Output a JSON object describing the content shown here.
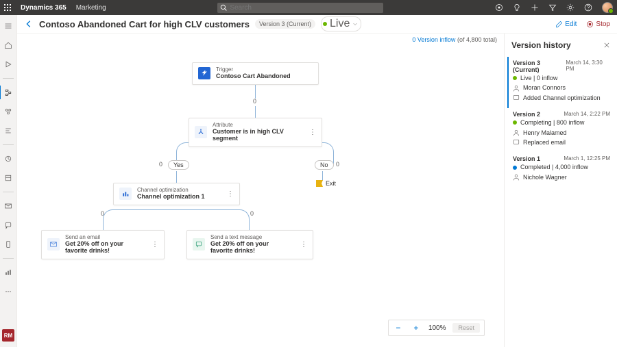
{
  "topbar": {
    "brand": "Dynamics 365",
    "app": "Marketing",
    "search_placeholder": "Search"
  },
  "rail_bottom": "RM",
  "header": {
    "title": "Contoso Abandoned Cart for high CLV customers",
    "version_pill": "Version 3 (Current)",
    "live_label": "Live",
    "edit": "Edit",
    "stop": "Stop"
  },
  "inflow": {
    "count": "0 Version inflow",
    "total": "(of 4,800 total)"
  },
  "nodes": {
    "trigger": {
      "label": "Trigger",
      "value": "Contoso Cart Abandoned"
    },
    "attribute": {
      "label": "Attribute",
      "value": "Customer is in high CLV segment"
    },
    "chopt": {
      "label": "Channel optimization",
      "value": "Channel optimization 1"
    },
    "email": {
      "label": "Send an email",
      "value": "Get 20% off on your favorite drinks!"
    },
    "sms": {
      "label": "Send a text message",
      "value": "Get 20% off on your favorite drinks!"
    },
    "yes": "Yes",
    "no": "No",
    "exit": "Exit",
    "c0": "0"
  },
  "zoom": {
    "level": "100%",
    "reset": "Reset"
  },
  "panel": {
    "title": "Version history",
    "versions": [
      {
        "name": "Version 3 (Current)",
        "time": "March 14, 3:30 PM",
        "status": "Live | 0 inflow",
        "dot": "green",
        "person": "Moran Connors",
        "note": "Added Channel optimization"
      },
      {
        "name": "Version 2",
        "time": "March 14, 2:22 PM",
        "status": "Completing | 800 inflow",
        "dot": "green",
        "person": "Henry Malamed",
        "note": "Replaced email"
      },
      {
        "name": "Version 1",
        "time": "March 1, 12:25 PM",
        "status": "Completed | 4,000 inflow",
        "dot": "blue",
        "person": "Nichole Wagner",
        "note": ""
      }
    ]
  }
}
